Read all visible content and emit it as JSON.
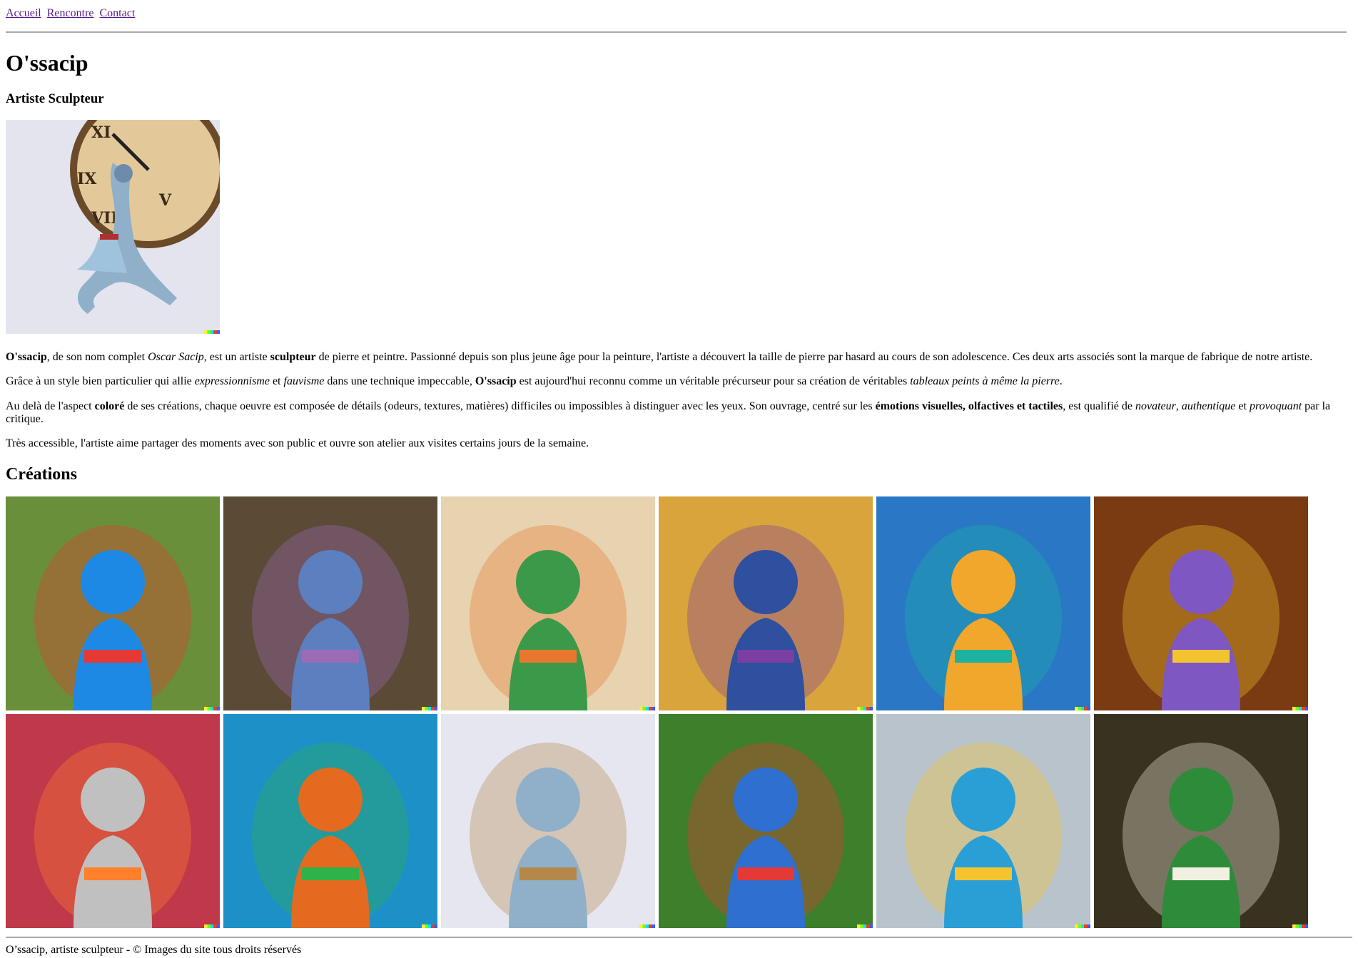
{
  "nav": {
    "items": [
      "Accueil",
      "Rencontre",
      "Contact"
    ]
  },
  "header": {
    "title": "O'ssacip",
    "subtitle": "Artiste Sculpteur"
  },
  "hero": {
    "icon": "clock-dancer-sculpture-image"
  },
  "intro": {
    "p1": {
      "a": "O'ssacip",
      "b": ", de son nom complet ",
      "c": "Oscar Sacip",
      "d": ", est un artiste ",
      "e": "sculpteur",
      "f": " de pierre et peintre. Passionné depuis son plus jeune âge pour la peinture, l'artiste a découvert la taille de pierre par hasard au cours de son adolescence. Ces deux arts associés sont la marque de fabrique de notre artiste."
    },
    "p2": {
      "a": "Grâce à un style bien particulier qui allie ",
      "b": "expressionnisme",
      "c": " et ",
      "d": "fauvisme",
      "e": " dans une technique impeccable, ",
      "f": "O'ssacip",
      "g": " est aujourd'hui reconnu comme un véritable précurseur pour sa création de véritables ",
      "h": "tableaux peints à même la pierre",
      "i": "."
    },
    "p3": {
      "a": "Au delà de l'aspect ",
      "b": "coloré",
      "c": " de ses créations, chaque oeuvre est composée de détails (odeurs, textures, matières) difficiles ou impossibles à distinguer avec les yeux. Son ouvrage, centré sur les ",
      "d": "émotions visuelles, olfactives et tactiles",
      "e": ", est qualifié de ",
      "f": "novateur",
      "g": ", ",
      "h": "authentique",
      "i": " et ",
      "j": "provoquant",
      "k": " par la critique."
    },
    "p4": "Très accessible, l'artiste aime partager des moments avec son public et ouvre son atelier aux visites certains jours de la semaine."
  },
  "creations": {
    "title": "Créations",
    "items": [
      {
        "icon": "baker-statue-image",
        "bg": "#6a8f3a",
        "main": "#1e88e5",
        "accent": "#e53935"
      },
      {
        "icon": "girl-with-bear-statue-image",
        "bg": "#5b4a36",
        "main": "#5c7fbf",
        "accent": "#9c6bb5"
      },
      {
        "icon": "wall-climber-statue-image",
        "bg": "#e7d3b0",
        "main": "#3a9a4a",
        "accent": "#e8772e"
      },
      {
        "icon": "clock-figure-statue-image",
        "bg": "#d9a43b",
        "main": "#2f4f9f",
        "accent": "#7a3fa0"
      },
      {
        "icon": "cat-woman-statue-image",
        "bg": "#2a78c5",
        "main": "#f0a72b",
        "accent": "#1bb3a0"
      },
      {
        "icon": "rat-ladder-statue-image",
        "bg": "#7a3b12",
        "main": "#7e57c2",
        "accent": "#f4c430"
      },
      {
        "icon": "rainbow-cat-statue-image",
        "bg": "#c0394a",
        "main": "#c0c0c0",
        "accent": "#ff7f2a"
      },
      {
        "icon": "laughing-dog-statue-image",
        "bg": "#1e90c8",
        "main": "#e36a1f",
        "accent": "#2db34a"
      },
      {
        "icon": "clock-dancer-sculpture-image",
        "bg": "#e6e6f0",
        "main": "#8fb0c8",
        "accent": "#b5884a"
      },
      {
        "icon": "rainbow-child-statue-image",
        "bg": "#3d7f2a",
        "main": "#2f6fd0",
        "accent": "#e53935"
      },
      {
        "icon": "laptop-figure-statue-image",
        "bg": "#b9c3cb",
        "main": "#2a9fd6",
        "accent": "#f4c430"
      },
      {
        "icon": "frog-lamp-statue-image",
        "bg": "#3a3220",
        "main": "#2e8b3a",
        "accent": "#f2f0e0"
      }
    ]
  },
  "footer": {
    "text": "O’ssacip, artiste sculpteur - © Images du site tous droits réservés"
  }
}
